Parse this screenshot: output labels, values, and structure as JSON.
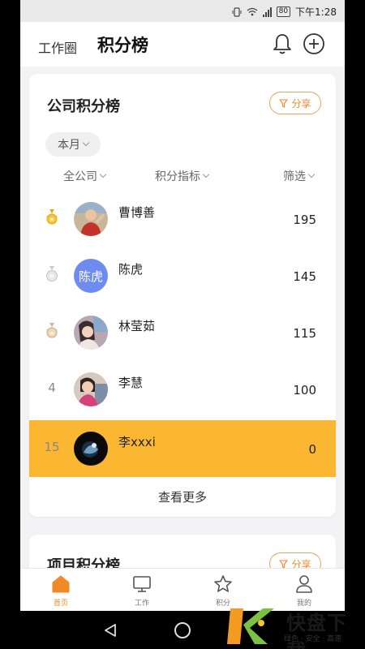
{
  "status_bar": {
    "time": "下午1:28",
    "battery": "80"
  },
  "header": {
    "tab_work": "工作圈",
    "tab_rank": "积分榜"
  },
  "company_card": {
    "title": "公司积分榜",
    "share_label": "分享",
    "period": "本月",
    "filters": {
      "scope": "全公司",
      "metric": "积分指标",
      "filter": "筛选"
    },
    "rows": [
      {
        "rank": "1",
        "name": "曹博善",
        "score": "195",
        "avatar_type": "photo"
      },
      {
        "rank": "2",
        "name": "陈虎",
        "score": "145",
        "avatar_type": "text",
        "avatar_text": "陈虎"
      },
      {
        "rank": "3",
        "name": "林莹茹",
        "score": "115",
        "avatar_type": "photo"
      },
      {
        "rank": "4",
        "name": "李慧",
        "score": "100",
        "avatar_type": "photo"
      },
      {
        "rank": "15",
        "name": "李xxxi",
        "score": "0",
        "avatar_type": "photo"
      }
    ],
    "more_label": "查看更多"
  },
  "project_card": {
    "title": "项目积分榜",
    "share_label": "分享"
  },
  "bottom_nav": [
    {
      "label": "首页",
      "icon": "home-icon",
      "active": true
    },
    {
      "label": "工作",
      "icon": "monitor-icon",
      "active": false
    },
    {
      "label": "积分",
      "icon": "star-icon",
      "active": false
    },
    {
      "label": "我的",
      "icon": "person-icon",
      "active": false
    }
  ],
  "watermark": {
    "brand": "快盘下载",
    "tagline": "绿色 · 安全 · 高速"
  },
  "colors": {
    "accent": "#f08a28",
    "highlight_row": "#fbb731",
    "avatar_text_bg": "#6e8cf0"
  }
}
